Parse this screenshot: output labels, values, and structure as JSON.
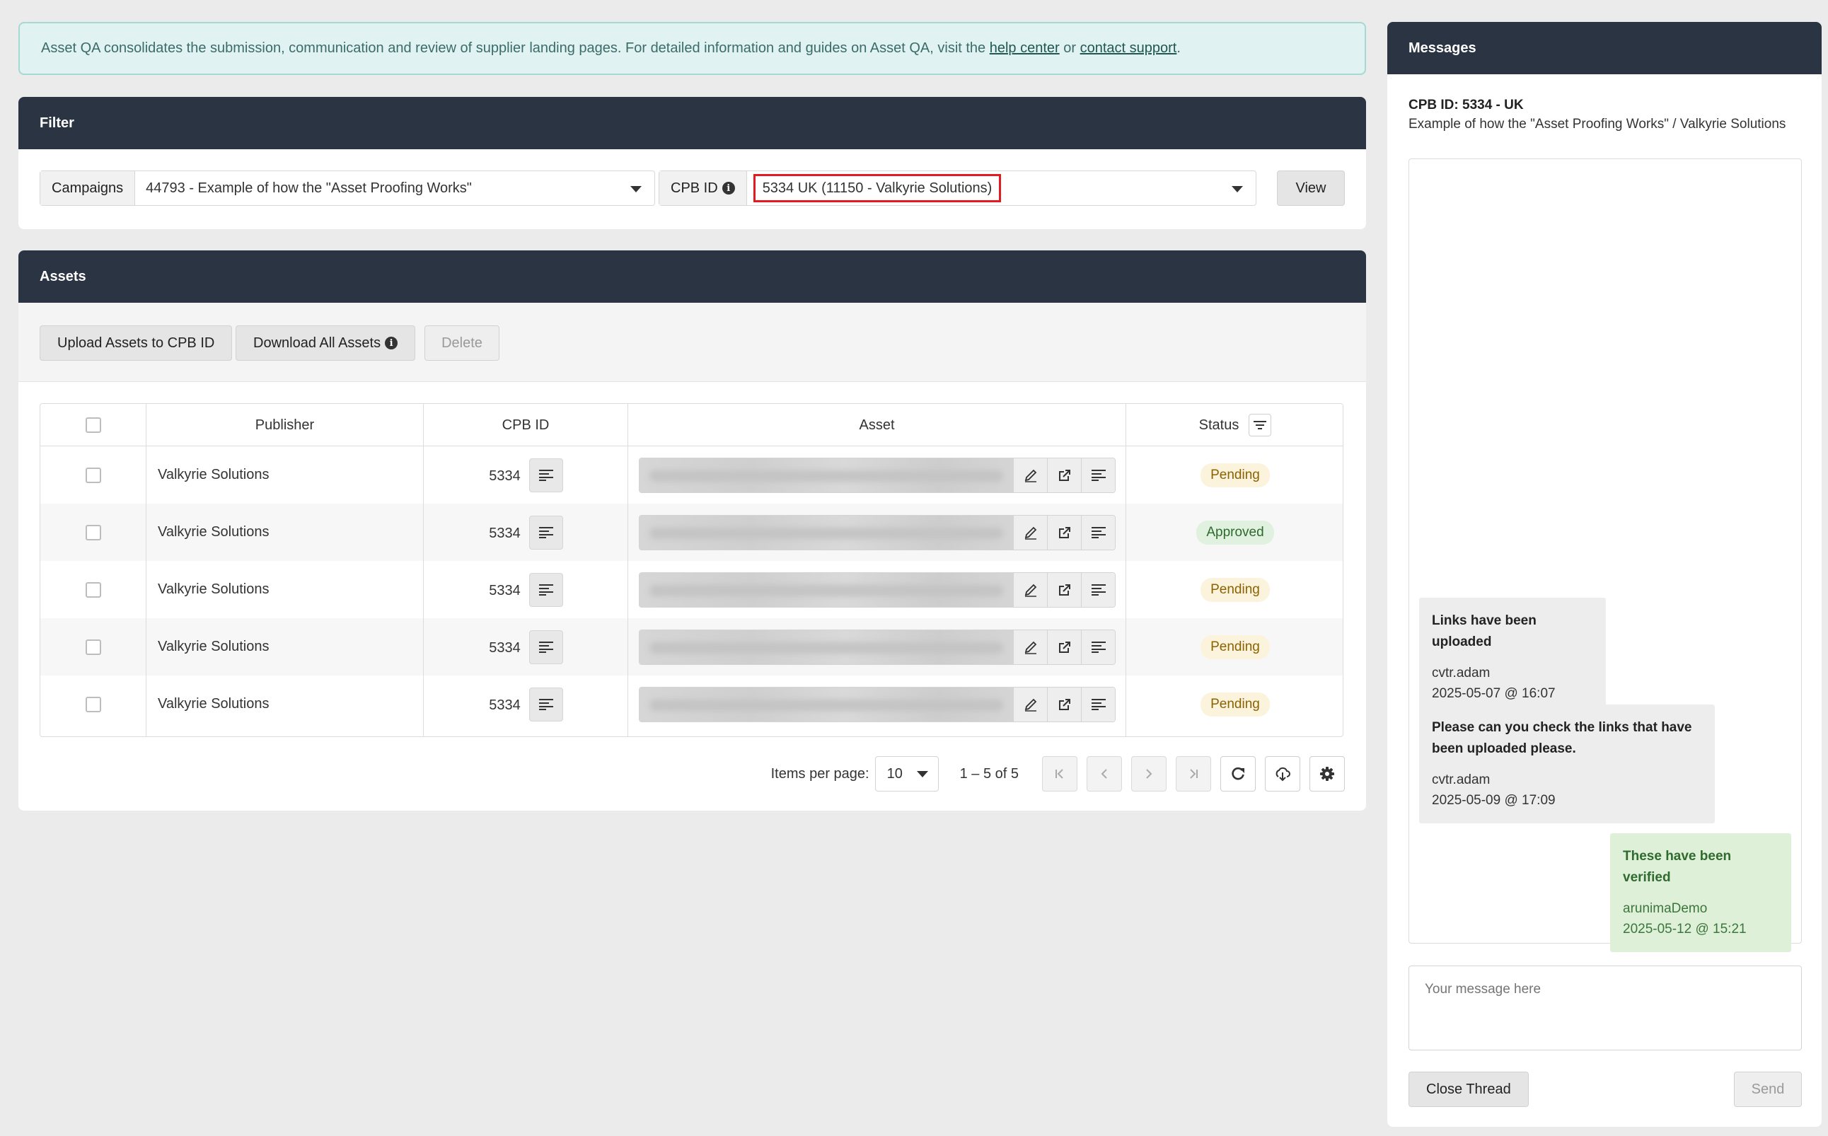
{
  "banner": {
    "text_before": "Asset QA consolidates the submission, communication and review of supplier landing pages. For detailed information and guides on Asset QA, visit the ",
    "help_link": "help center",
    "text_middle": " or ",
    "support_link": "contact support",
    "text_after": "."
  },
  "filter": {
    "title": "Filter",
    "campaigns_label": "Campaigns",
    "campaigns_value": "44793 - Example of how the \"Asset Proofing Works\"",
    "cpb_label": "CPB ID",
    "cpb_value": "5334 UK (11150 - Valkyrie Solutions)",
    "view_button": "View"
  },
  "assets": {
    "title": "Assets",
    "upload_button": "Upload Assets to CPB ID",
    "download_button": "Download All Assets",
    "delete_button": "Delete",
    "columns": {
      "publisher": "Publisher",
      "cpb_id": "CPB ID",
      "asset": "Asset",
      "status": "Status"
    },
    "rows": [
      {
        "publisher": "Valkyrie Solutions",
        "cpb_id": "5334",
        "status": "Pending"
      },
      {
        "publisher": "Valkyrie Solutions",
        "cpb_id": "5334",
        "status": "Approved"
      },
      {
        "publisher": "Valkyrie Solutions",
        "cpb_id": "5334",
        "status": "Pending"
      },
      {
        "publisher": "Valkyrie Solutions",
        "cpb_id": "5334",
        "status": "Pending"
      },
      {
        "publisher": "Valkyrie Solutions",
        "cpb_id": "5334",
        "status": "Pending"
      }
    ],
    "paginator": {
      "items_per_page_label": "Items per page:",
      "items_per_page_value": "10",
      "range": "1 – 5 of 5"
    }
  },
  "messages": {
    "title": "Messages",
    "thread_title": "CPB ID: 5334 - UK",
    "thread_subtitle": "Example of how the \"Asset Proofing Works\" / Valkyrie Solutions",
    "items": [
      {
        "text": "Links have been uploaded",
        "user": "cvtr.adam",
        "time": "2025-05-07 @ 16:07"
      },
      {
        "text": "Please can you check the links that have been uploaded please.",
        "user": "cvtr.adam",
        "time": "2025-05-09 @ 17:09"
      },
      {
        "text": "These have been verified",
        "user": "arunimaDemo",
        "time": "2025-05-12 @ 15:21"
      }
    ],
    "placeholder": "Your message here",
    "close_button": "Close Thread",
    "send_button": "Send"
  },
  "colors": {
    "header_bg": "#2b3442",
    "pending_text": "#8c6200",
    "approved_text": "#2d6a2b",
    "highlight_border": "#e01b22"
  }
}
